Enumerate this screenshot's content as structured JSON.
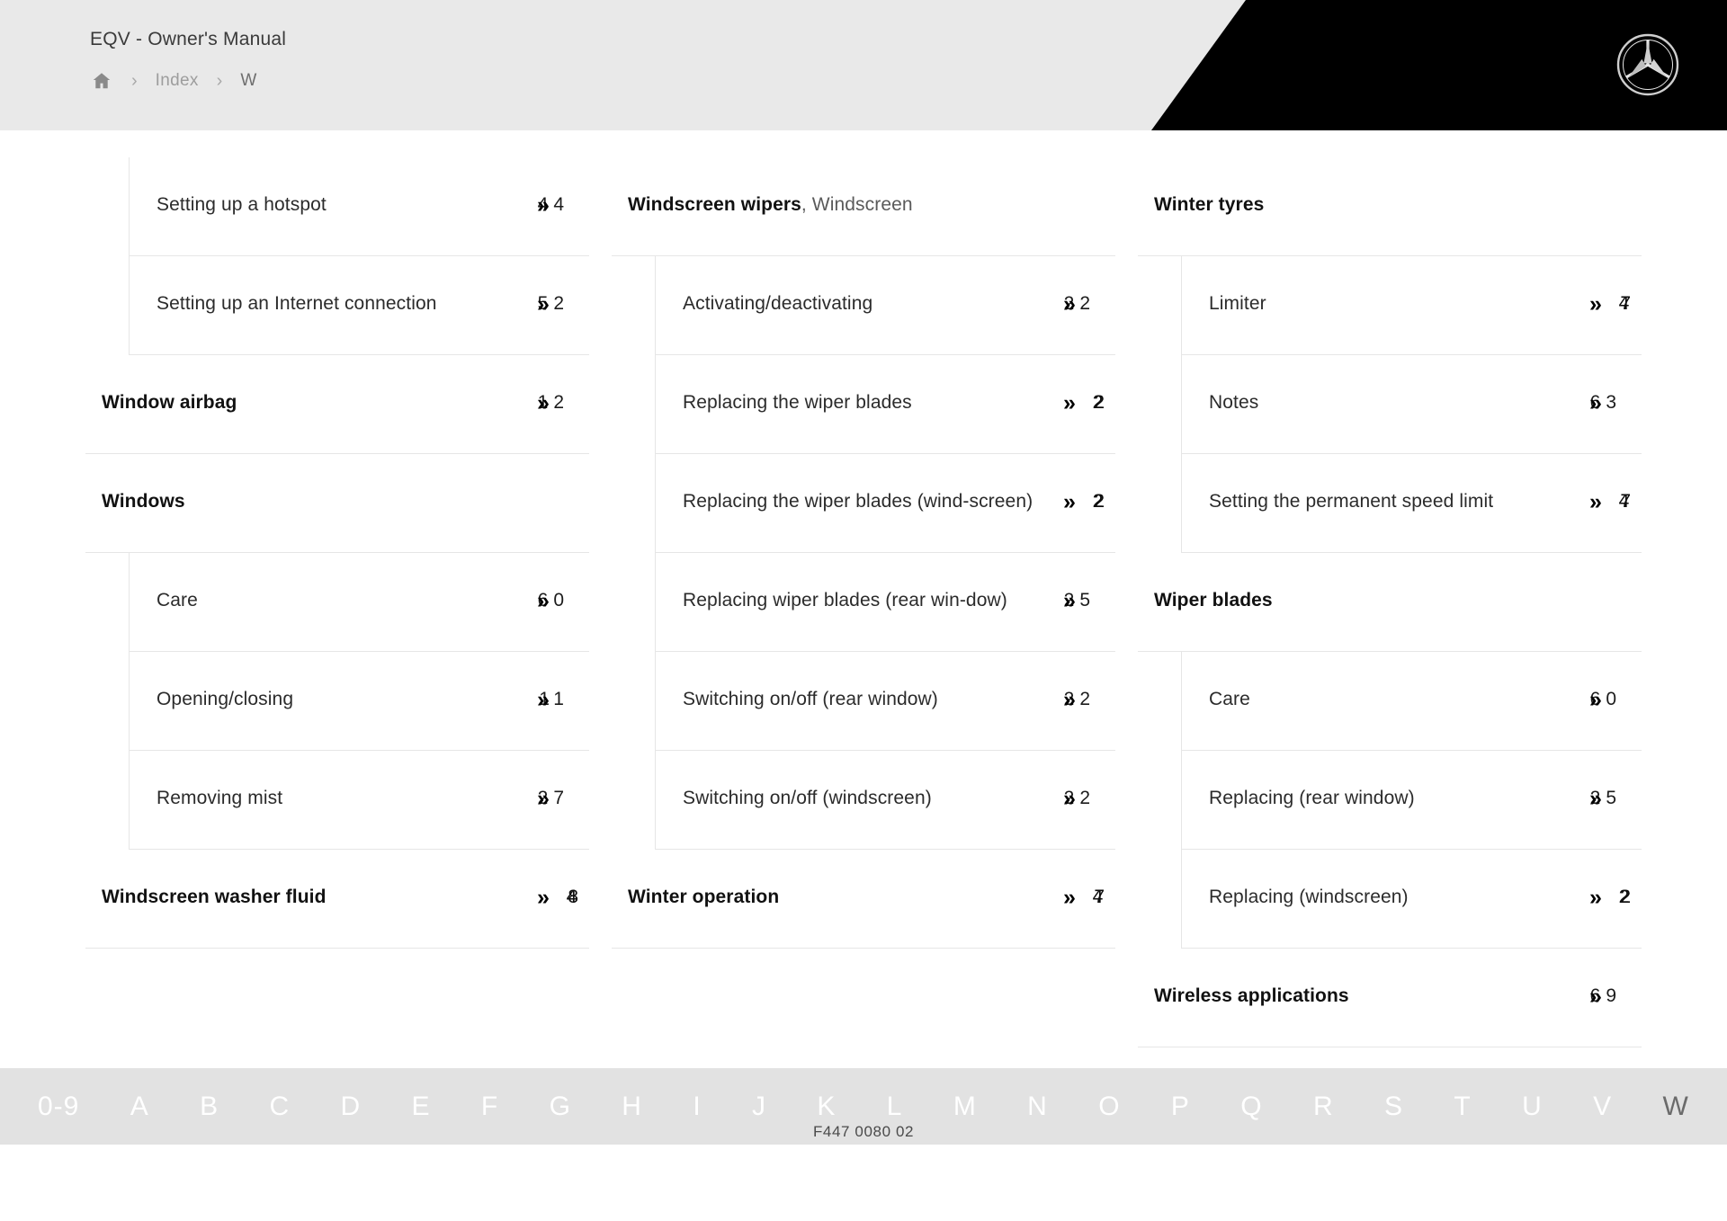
{
  "header": {
    "title": "EQV - Owner's Manual",
    "breadcrumb": {
      "home_icon": "home-icon",
      "separator": "›",
      "items": [
        {
          "label": "Index",
          "current": false
        },
        {
          "label": "W",
          "current": true
        }
      ]
    },
    "brand_logo": "mercedes-benz-star-logo"
  },
  "index": {
    "arrow_glyph": "»",
    "columns": [
      {
        "groups": [
          {
            "heading": null,
            "children": [
              {
                "label": "Setting up a hotspot",
                "page": "44",
                "tight": false
              },
              {
                "label": "Setting up an Internet connection",
                "page": "52",
                "tight": false
              }
            ]
          },
          {
            "heading": {
              "label": "Window airbag",
              "page": "12",
              "tight": false
            },
            "children": []
          },
          {
            "heading": {
              "label": "Windows",
              "page": "",
              "tight": false
            },
            "children": [
              {
                "label": "Care",
                "page": "60",
                "tight": false
              },
              {
                "label": "Opening/closing",
                "page": "11",
                "tight": false
              },
              {
                "label": "Removing mist",
                "page": "27",
                "tight": false
              }
            ]
          },
          {
            "heading": {
              "label": "Windscreen washer fluid",
              "page": "48",
              "tight": true
            },
            "children": []
          }
        ]
      },
      {
        "groups": [
          {
            "heading": {
              "label": "Windscreen wipers",
              "sub": ", Windscreen",
              "page": "",
              "tight": false
            },
            "children": [
              {
                "label": "Activating/deactivating",
                "page": "22",
                "tight": false
              },
              {
                "label": "Replacing the wiper blades",
                "page": "22",
                "tight": true
              },
              {
                "label": "Replacing the wiper blades (wind-screen)",
                "page": "22",
                "tight": true
              },
              {
                "label": "Replacing wiper blades (rear win-dow)",
                "page": "25",
                "tight": false
              },
              {
                "label": "Switching on/off (rear window)",
                "page": "22",
                "tight": false
              },
              {
                "label": "Switching on/off (windscreen)",
                "page": "22",
                "tight": false
              }
            ]
          },
          {
            "heading": {
              "label": "Winter operation",
              "page": "47",
              "tight": true
            },
            "children": []
          }
        ]
      },
      {
        "groups": [
          {
            "heading": {
              "label": "Winter tyres",
              "page": "",
              "tight": false
            },
            "children": [
              {
                "label": "Limiter",
                "page": "47",
                "tight": true
              },
              {
                "label": "Notes",
                "page": "63",
                "tight": false
              },
              {
                "label": "Setting the permanent speed limit",
                "page": "47",
                "tight": true
              }
            ]
          },
          {
            "heading": {
              "label": "Wiper blades",
              "page": "",
              "tight": false
            },
            "children": [
              {
                "label": "Care",
                "page": "60",
                "tight": false
              },
              {
                "label": "Replacing (rear window)",
                "page": "25",
                "tight": false
              },
              {
                "label": "Replacing (windscreen)",
                "page": "22",
                "tight": true
              }
            ]
          },
          {
            "heading": {
              "label": "Wireless applications",
              "page": "69",
              "tight": false
            },
            "children": []
          }
        ]
      }
    ]
  },
  "alphabet_bar": {
    "letters": [
      "0-9",
      "A",
      "B",
      "C",
      "D",
      "E",
      "F",
      "G",
      "H",
      "I",
      "J",
      "K",
      "L",
      "M",
      "N",
      "O",
      "P",
      "Q",
      "R",
      "S",
      "T",
      "U",
      "V",
      "W"
    ],
    "active": "W"
  },
  "footer": {
    "document_code": "F447 0080 02"
  },
  "colors": {
    "header_bg": "#e9e9e9",
    "header_black": "#000000",
    "alphabar_bg": "#e2e2e2",
    "active_letter": "#6b6b6b",
    "rule": "#e6e6e6"
  }
}
